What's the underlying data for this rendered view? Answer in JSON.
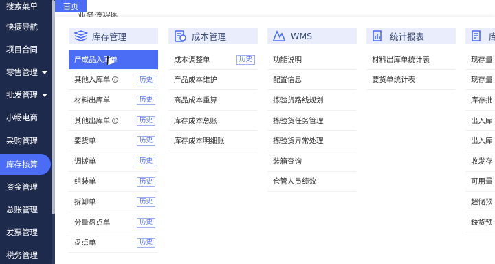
{
  "sidebar": {
    "items": [
      {
        "label": "搜索菜单",
        "arrow": false,
        "active": false
      },
      {
        "label": "快捷导航",
        "arrow": false,
        "active": false
      },
      {
        "label": "项目合同",
        "arrow": false,
        "active": false
      },
      {
        "label": "零售管理",
        "arrow": true,
        "active": false
      },
      {
        "label": "批发管理",
        "arrow": true,
        "active": false
      },
      {
        "label": "小畅电商",
        "arrow": false,
        "active": false
      },
      {
        "label": "采购管理",
        "arrow": false,
        "active": false
      },
      {
        "label": "库存核算",
        "arrow": false,
        "active": true
      },
      {
        "label": "资金管理",
        "arrow": false,
        "active": false
      },
      {
        "label": "总账管理",
        "arrow": false,
        "active": false
      },
      {
        "label": "发票管理",
        "arrow": false,
        "active": false
      },
      {
        "label": "税务管理",
        "arrow": false,
        "active": false
      }
    ]
  },
  "tabs": {
    "home": "首页",
    "ghost": "业务流程图"
  },
  "history_label": "历史",
  "columns": [
    {
      "title": "库存管理",
      "icon": "inventory-icon",
      "items": [
        {
          "label": "产成品入库单",
          "selected": true,
          "history": false,
          "help": false
        },
        {
          "label": "其他入库单",
          "selected": false,
          "history": true,
          "help": true
        },
        {
          "label": "材料出库单",
          "selected": false,
          "history": true,
          "help": false
        },
        {
          "label": "其他出库单",
          "selected": false,
          "history": true,
          "help": true
        },
        {
          "label": "要货单",
          "selected": false,
          "history": true,
          "help": false
        },
        {
          "label": "调拨单",
          "selected": false,
          "history": true,
          "help": false
        },
        {
          "label": "组装单",
          "selected": false,
          "history": true,
          "help": false
        },
        {
          "label": "拆卸单",
          "selected": false,
          "history": true,
          "help": false
        },
        {
          "label": "分量盘点单",
          "selected": false,
          "history": true,
          "help": false
        },
        {
          "label": "盘点单",
          "selected": false,
          "history": true,
          "help": false
        }
      ]
    },
    {
      "title": "成本管理",
      "icon": "cost-icon",
      "items": [
        {
          "label": "成本调整单",
          "selected": false,
          "history": true,
          "help": false
        },
        {
          "label": "产品成本维护",
          "selected": false,
          "history": false,
          "help": false
        },
        {
          "label": "商品成本重算",
          "selected": false,
          "history": false,
          "help": false
        },
        {
          "label": "库存成本总账",
          "selected": false,
          "history": false,
          "help": false
        },
        {
          "label": "库存成本明细账",
          "selected": false,
          "history": false,
          "help": false
        }
      ]
    },
    {
      "title": "WMS",
      "icon": "wms-icon",
      "items": [
        {
          "label": "功能说明",
          "selected": false,
          "history": false,
          "help": false
        },
        {
          "label": "配置信息",
          "selected": false,
          "history": false,
          "help": false
        },
        {
          "label": "拣验货路线规划",
          "selected": false,
          "history": false,
          "help": false
        },
        {
          "label": "拣验货任务管理",
          "selected": false,
          "history": false,
          "help": false
        },
        {
          "label": "拣验货异常处理",
          "selected": false,
          "history": false,
          "help": false
        },
        {
          "label": "装箱查询",
          "selected": false,
          "history": false,
          "help": false
        },
        {
          "label": "仓管人员绩效",
          "selected": false,
          "history": false,
          "help": false
        }
      ]
    },
    {
      "title": "统计报表",
      "icon": "report-icon",
      "items": [
        {
          "label": "材料出库单统计表",
          "selected": false,
          "history": false,
          "help": false
        },
        {
          "label": "要货单统计表",
          "selected": false,
          "history": false,
          "help": false
        }
      ]
    },
    {
      "title": "库",
      "icon": "inventory-report-icon",
      "items": [
        {
          "label": "现存量",
          "selected": false,
          "history": false,
          "help": false
        },
        {
          "label": "现存量",
          "selected": false,
          "history": false,
          "help": false
        },
        {
          "label": "库存批",
          "selected": false,
          "history": false,
          "help": false
        },
        {
          "label": "出入库",
          "selected": false,
          "history": false,
          "help": false
        },
        {
          "label": "出入库",
          "selected": false,
          "history": false,
          "help": false
        },
        {
          "label": "收发存",
          "selected": false,
          "history": false,
          "help": false
        },
        {
          "label": "可用量",
          "selected": false,
          "history": false,
          "help": false
        },
        {
          "label": "超储预",
          "selected": false,
          "history": false,
          "help": false
        },
        {
          "label": "缺货预",
          "selected": false,
          "history": false,
          "help": false
        }
      ]
    }
  ]
}
